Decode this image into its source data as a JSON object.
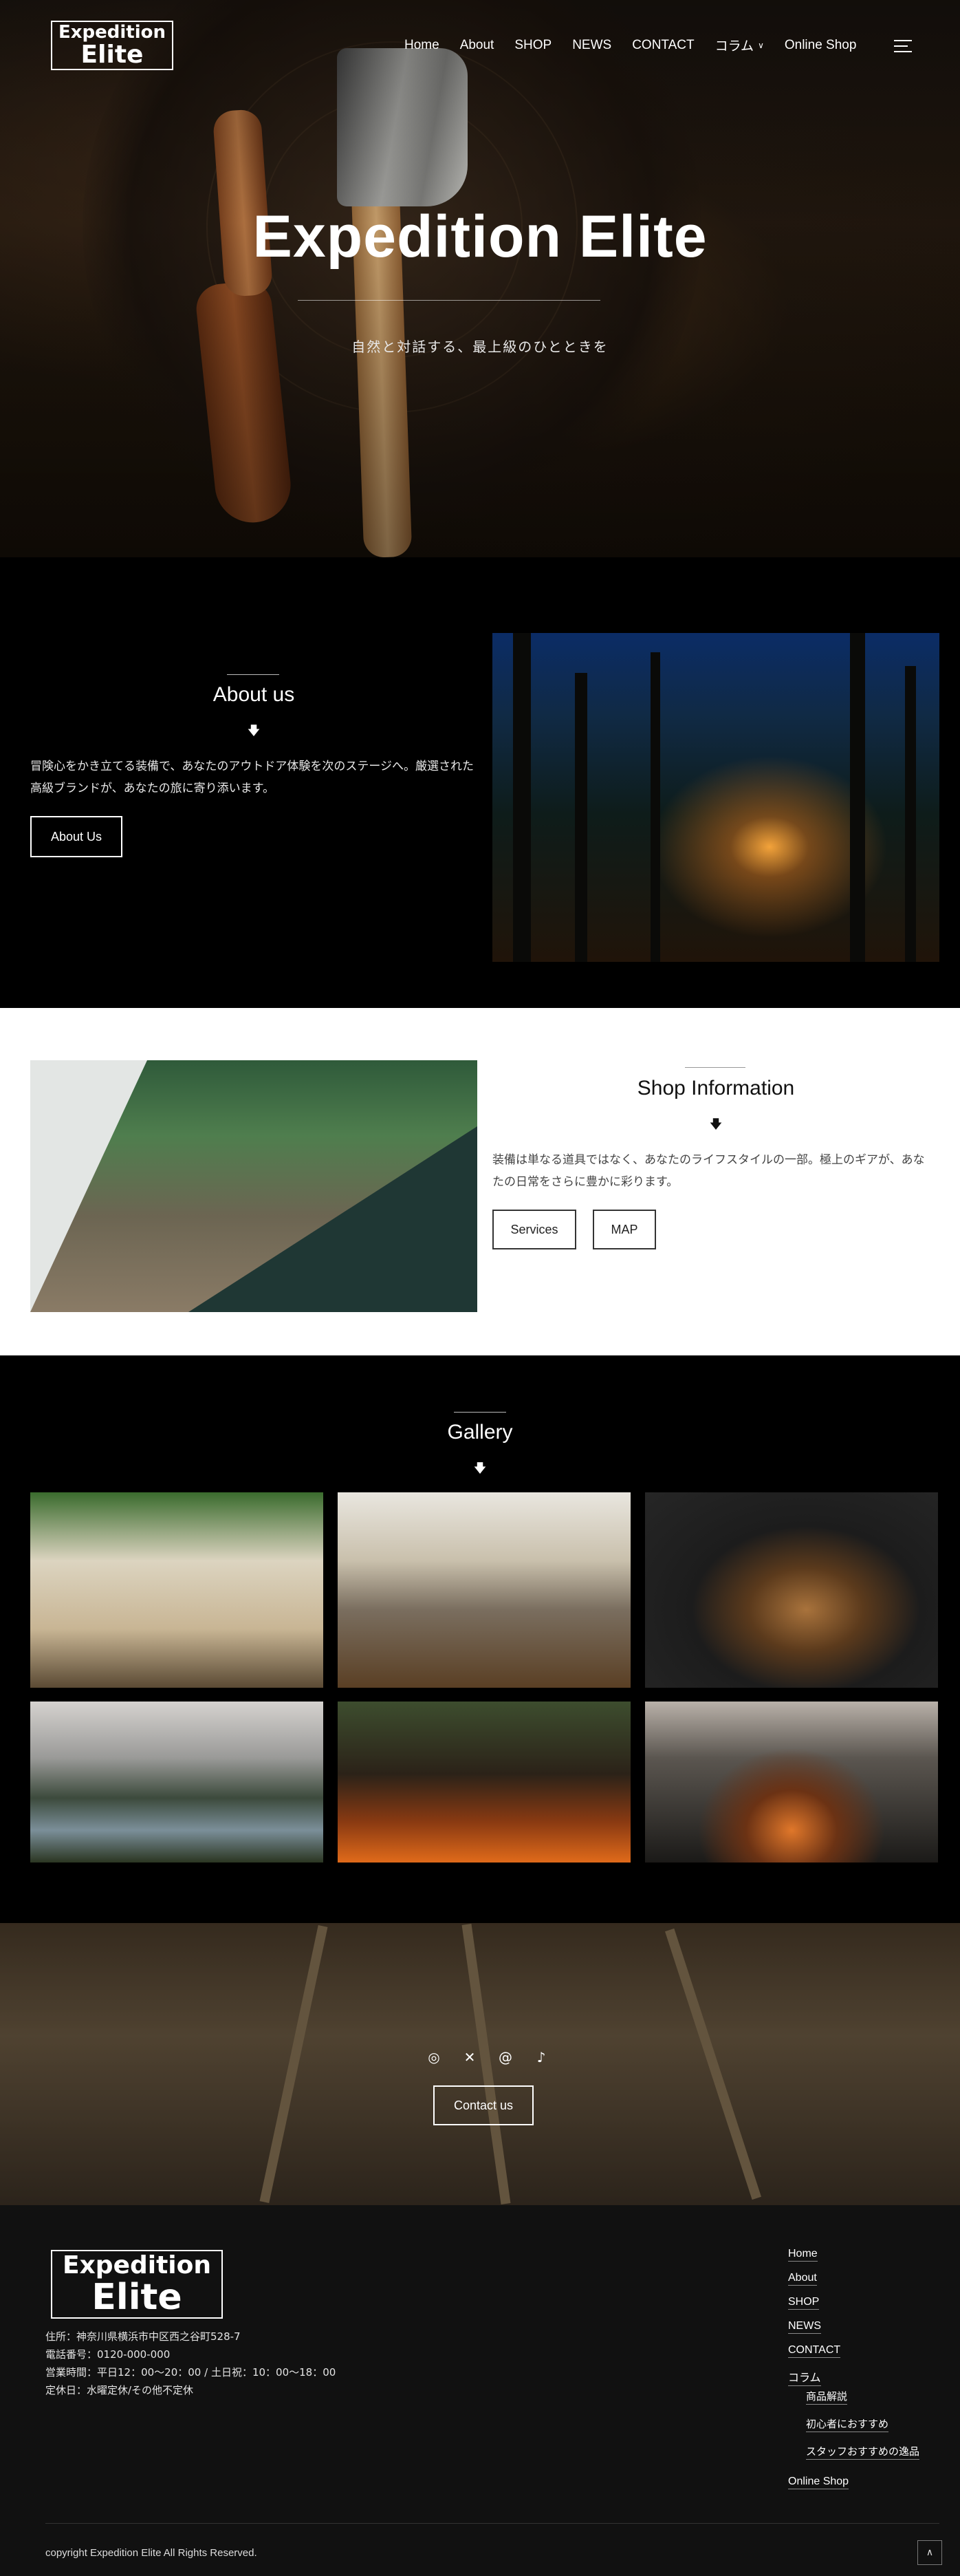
{
  "brand": {
    "line1": "Expedition",
    "line2": "Elite"
  },
  "nav": {
    "items": [
      "Home",
      "About",
      "SHOP",
      "NEWS",
      "CONTACT"
    ],
    "column_label": "コラム",
    "online_shop": "Online Shop",
    "icons": {
      "dropdown": "chevron-down-icon",
      "menu": "hamburger-menu-icon"
    }
  },
  "hero": {
    "title": "Expedition Elite",
    "subtitle": "自然と対話する、最上級のひとときを"
  },
  "about": {
    "title": "About us",
    "text": "冒険心をかき立てる装備で、あなたのアウトドア体験を次のステージへ。厳選された高級ブランドが、あなたの旅に寄り添います。",
    "button": "About Us"
  },
  "shop": {
    "title": "Shop Information",
    "text": "装備は単なる道具ではなく、あなたのライフスタイルの一部。極上のギアが、あなたの日常をさらに豊かに彩ります。",
    "buttons": [
      "Services",
      "MAP"
    ]
  },
  "gallery": {
    "title": "Gallery",
    "images": [
      "tent-interior-photo",
      "camp-table-photo",
      "skillet-bread-photo",
      "mountain-lake-photo",
      "campfire-grill-photo",
      "lakeside-fire-photo"
    ]
  },
  "contact": {
    "button": "Contact us",
    "social_icons": [
      "instagram-icon",
      "x-icon",
      "threads-icon",
      "tiktok-icon"
    ]
  },
  "footer": {
    "address": "住所：神奈川県横浜市中区西之谷町528-7",
    "phone": "電話番号：0120-000-000",
    "hours": "営業時間：平日12：00〜20：00 / 土日祝：10：00〜18：00",
    "closed": "定休日：水曜定休/その他不定休",
    "nav": [
      "Home",
      "About",
      "SHOP",
      "NEWS",
      "CONTACT",
      "コラム"
    ],
    "column_sub": [
      "商品解説",
      "初心者におすすめ",
      "スタッフおすすめの逸品"
    ],
    "online_shop": "Online Shop",
    "copyright": "copyright Expedition Elite All Rights Reserved.",
    "totop_icon": "chevron-up-icon"
  },
  "colors": {
    "dark_bg": "#000000",
    "footer_bg": "#111111",
    "light_bg": "#ffffff"
  }
}
